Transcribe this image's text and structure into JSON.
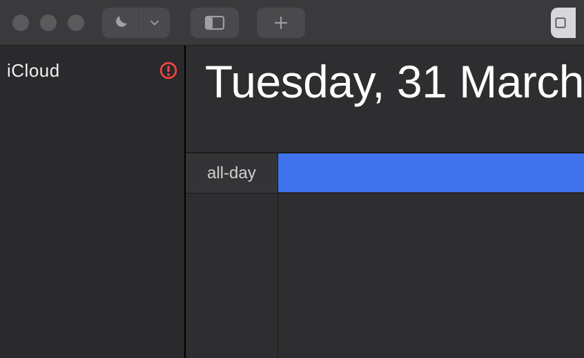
{
  "sidebar": {
    "section_title": "iCloud"
  },
  "main": {
    "date_title": "Tuesday, 31 March",
    "allday_label": "all-day"
  },
  "colors": {
    "event_blue": "#3f72ec",
    "alert_red": "#ff453a"
  }
}
